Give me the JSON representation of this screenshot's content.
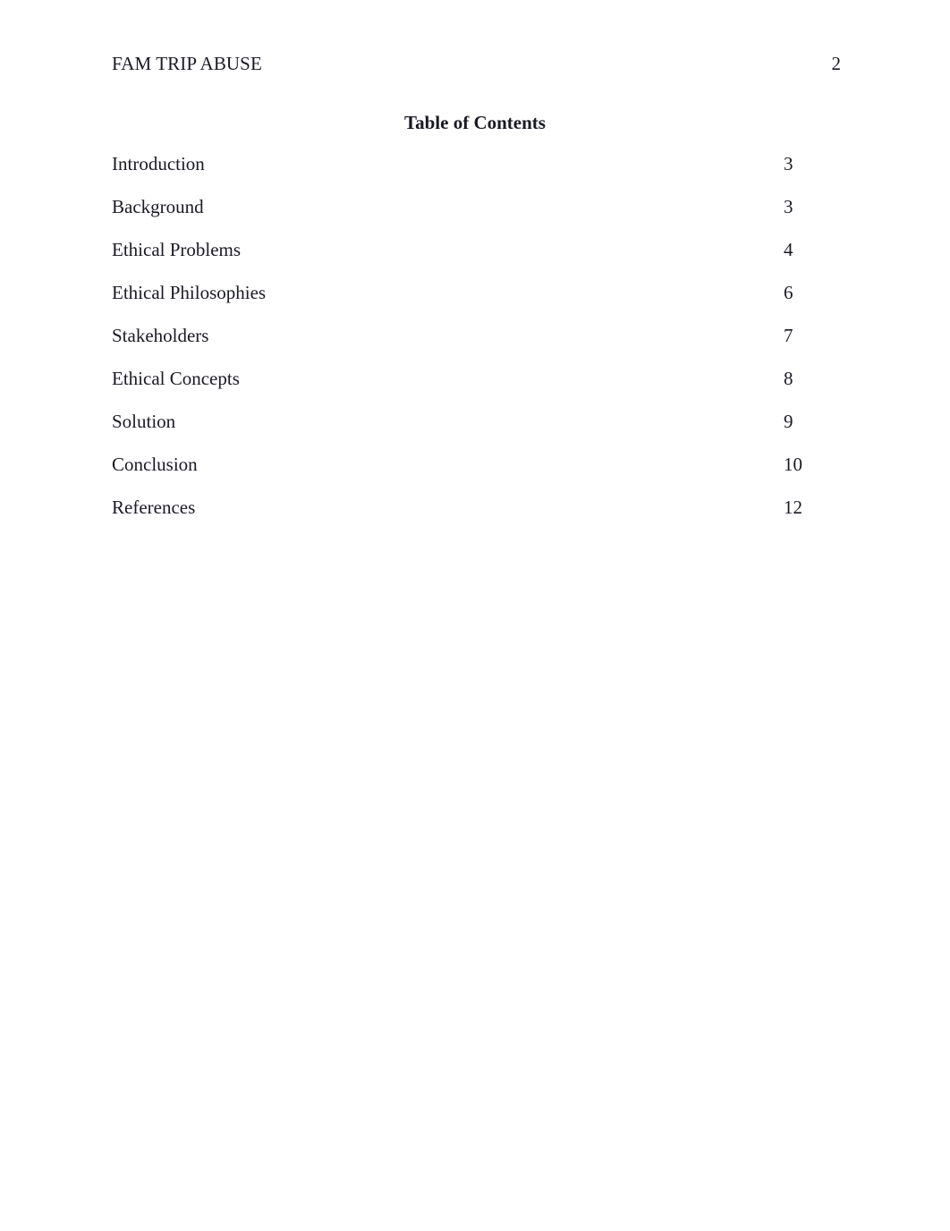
{
  "document": {
    "running_header": {
      "title": "FAM TRIP ABUSE",
      "page_number": "2"
    },
    "heading": "Table of Contents",
    "toc_entries": [
      {
        "label": "Introduction",
        "page": "3"
      },
      {
        "label": "Background",
        "page": "3"
      },
      {
        "label": "Ethical Problems",
        "page": "4"
      },
      {
        "label": "Ethical Philosophies",
        "page": "6"
      },
      {
        "label": "Stakeholders",
        "page": "7"
      },
      {
        "label": "Ethical Concepts",
        "page": "8"
      },
      {
        "label": "Solution",
        "page": "9"
      },
      {
        "label": "Conclusion",
        "page": "10"
      },
      {
        "label": "References",
        "page": "12"
      }
    ]
  }
}
